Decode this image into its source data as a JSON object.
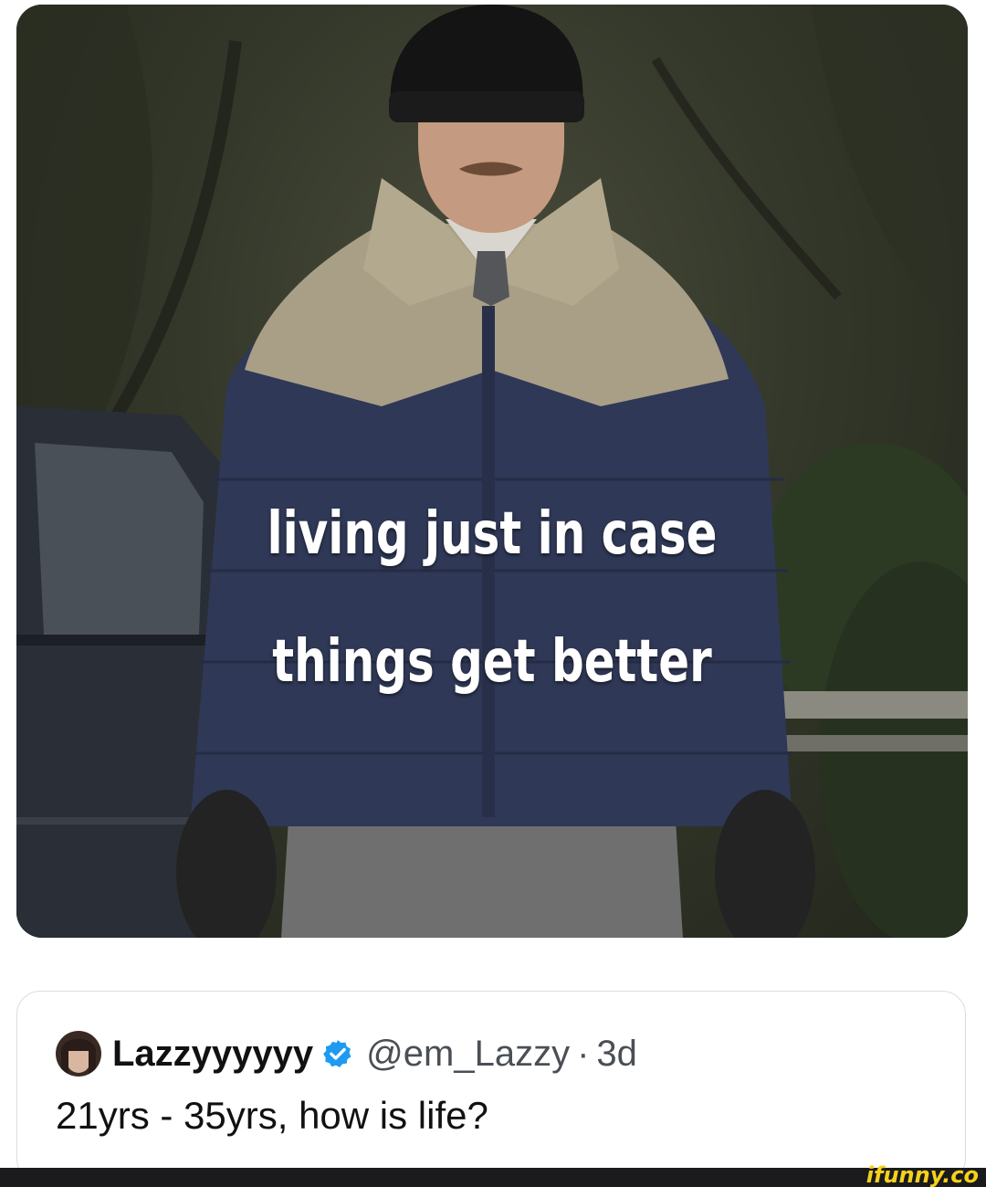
{
  "photo": {
    "caption_line1": "living just in case",
    "caption_line2": "things get better"
  },
  "tweet": {
    "display_name": "Lazzyyyyyy",
    "verified_icon": "verified-badge-icon",
    "handle": "@em_Lazzy",
    "separator": "·",
    "age": "3d",
    "text": "21yrs - 35yrs, how is life?"
  },
  "watermark": {
    "text": "ifunny.co",
    "color": "#f4d21c"
  },
  "colors": {
    "verified_blue": "#1d9bf0",
    "bar_background": "#1b1b1d"
  }
}
